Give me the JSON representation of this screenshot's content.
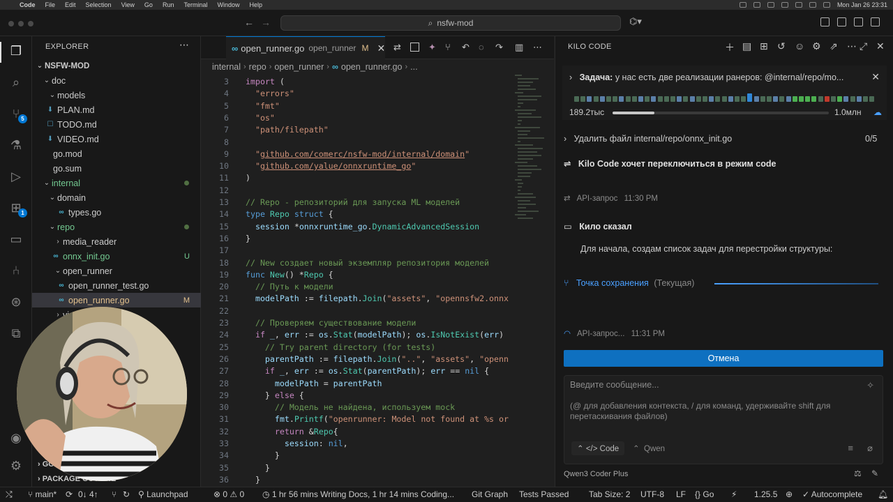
{
  "menubar": {
    "app": "Code",
    "items": [
      "File",
      "Edit",
      "Selection",
      "View",
      "Go",
      "Run",
      "Terminal",
      "Window",
      "Help"
    ],
    "clock": "Mon Jan 26  23:31"
  },
  "titlebar": {
    "search": "nsfw-mod"
  },
  "explorer": {
    "title": "EXPLORER",
    "root": "NSFW-MOD",
    "items": [
      {
        "label": "doc",
        "type": "folder-open",
        "indent": 1
      },
      {
        "label": "models",
        "type": "folder-open",
        "indent": 2
      },
      {
        "label": "PLAN.md",
        "type": "md",
        "indent": 2
      },
      {
        "label": "TODO.md",
        "type": "md",
        "indent": 2
      },
      {
        "label": "VIDEO.md",
        "type": "md",
        "indent": 2
      },
      {
        "label": "go.mod",
        "type": "file",
        "indent": 1
      },
      {
        "label": "go.sum",
        "type": "file",
        "indent": 1
      },
      {
        "label": "internal",
        "type": "folder-open",
        "indent": 1
      },
      {
        "label": "domain",
        "type": "folder-open",
        "indent": 2
      },
      {
        "label": "types.go",
        "type": "go",
        "indent": 3
      },
      {
        "label": "repo",
        "type": "folder-open",
        "indent": 2
      },
      {
        "label": "media_reader",
        "type": "folder-closed",
        "indent": 3
      },
      {
        "label": "onnx_init.go",
        "type": "go",
        "indent": 3,
        "status": "U"
      },
      {
        "label": "open_runner",
        "type": "folder-open",
        "indent": 3
      },
      {
        "label": "open_runner_test.go",
        "type": "go",
        "indent": 4
      },
      {
        "label": "open_runner.go",
        "type": "go",
        "indent": 4,
        "status": "M",
        "selected": true
      },
      {
        "label": "vi",
        "type": "folder-closed",
        "indent": 3
      }
    ],
    "bottom_sections": [
      "GO",
      "PACKAGE OUTLINE"
    ]
  },
  "editor": {
    "tab": {
      "name": "open_runner.go",
      "sub": "open_runner",
      "status": "M"
    },
    "breadcrumbs": [
      "internal",
      "repo",
      "open_runner",
      "open_runner.go",
      "..."
    ],
    "lines": [
      {
        "n": "3",
        "t": "import ("
      },
      {
        "n": "4",
        "t": "  \"errors\""
      },
      {
        "n": "5",
        "t": "  \"fmt\""
      },
      {
        "n": "6",
        "t": "  \"os\""
      },
      {
        "n": "7",
        "t": "  \"path/filepath\""
      },
      {
        "n": "8",
        "t": ""
      },
      {
        "n": "9",
        "t": "  \"github.com/comerc/nsfw-mod/internal/domain\""
      },
      {
        "n": "10",
        "t": "  \"github.com/yalue/onnxruntime_go\""
      },
      {
        "n": "11",
        "t": ")"
      },
      {
        "n": "12",
        "t": ""
      },
      {
        "n": "13",
        "t": "// Repo - репозиторий для запуска ML моделей"
      },
      {
        "n": "14",
        "t": "type Repo struct {"
      },
      {
        "n": "15",
        "t": "  session *onnxruntime_go.DynamicAdvancedSession"
      },
      {
        "n": "16",
        "t": "}"
      },
      {
        "n": "17",
        "t": ""
      },
      {
        "n": "18",
        "t": "// New создает новый экземпляр репозитория моделей"
      },
      {
        "n": "19",
        "t": "func New() *Repo {"
      },
      {
        "n": "20",
        "t": "  // Путь к модели"
      },
      {
        "n": "21",
        "t": "  modelPath := filepath.Join(\"assets\", \"opennsfw2.onnx"
      },
      {
        "n": "22",
        "t": ""
      },
      {
        "n": "23",
        "t": "  // Проверяем существование модели"
      },
      {
        "n": "24",
        "t": "  if _, err := os.Stat(modelPath); os.IsNotExist(err)"
      },
      {
        "n": "25",
        "t": "    // Try parent directory (for tests)"
      },
      {
        "n": "26",
        "t": "    parentPath := filepath.Join(\"..\", \"assets\", \"openn"
      },
      {
        "n": "27",
        "t": "    if _, err := os.Stat(parentPath); err == nil {"
      },
      {
        "n": "28",
        "t": "      modelPath = parentPath"
      },
      {
        "n": "29",
        "t": "    } else {"
      },
      {
        "n": "30",
        "t": "      // Модель не найдена, используем mock"
      },
      {
        "n": "31",
        "t": "      fmt.Printf(\"openrunner: Model not found at %s or"
      },
      {
        "n": "32",
        "t": "      return &Repo{"
      },
      {
        "n": "33",
        "t": "        session: nil,"
      },
      {
        "n": "34",
        "t": "      }"
      },
      {
        "n": "35",
        "t": "    }"
      },
      {
        "n": "36",
        "t": "  }"
      }
    ]
  },
  "kilo": {
    "title": "KILO CODE",
    "task_label": "Задача:",
    "task_text": "у нас есть две реализации ранеров: @internal/repo/mo...",
    "tokens_used": "189.2тыс",
    "tokens_max": "1.0млн",
    "todo_text": "Удалить файл internal/repo/onnx_init.go",
    "todo_count": "0/5",
    "switch_mode": "Kilo Code хочет переключиться в режим code",
    "api1_label": "API-запрос",
    "api1_time": "11:30 PM",
    "said_label": "Кило сказал",
    "said_text": "Для начала, создам список задач для перестройки структуры:",
    "checkpoint": "Точка сохранения",
    "checkpoint_sub": "(Текущая)",
    "api2_label": "API-запрос...",
    "api2_time": "11:31 PM",
    "cancel": "Отмена",
    "input_placeholder": "Введите сообщение...",
    "input_hint": "(@ для добавления контекста, / для команд, удерживайте shift для перетаскивания файлов)",
    "mode": "Code",
    "profile": "Qwen",
    "model": "Qwen3 Coder Plus",
    "segment_colors": [
      "#4a6a55",
      "#4a6a55",
      "#5b7fa8",
      "#4a6a55",
      "#5b7fa8",
      "#4a6a55",
      "#4a6a55",
      "#5b7fa8",
      "#4a6a55",
      "#4a6a55",
      "#5b7fa8",
      "#4a6a55",
      "#5b7fa8",
      "#4a6a55",
      "#4a6a55",
      "#4a6a55",
      "#5b7fa8",
      "#4a6a55",
      "#5b7fa8",
      "#4a6a55",
      "#4a6a55",
      "#5b7fa8",
      "#4a6a55",
      "#4a6a55",
      "#5b7fa8",
      "#4a6a55",
      "#4a6a55",
      "#2f87d8",
      "#5b7fa8",
      "#4a6a55",
      "#4a6a55",
      "#5b7fa8",
      "#4a6a55",
      "#5b7fa8",
      "#4caf50",
      "#4caf50",
      "#4caf50",
      "#4caf50",
      "#4a6a55",
      "#c0392b",
      "#4a6a55",
      "#4caf50",
      "#5b7fa8",
      "#4a6a55",
      "#5b7fa8",
      "#4a6a55",
      "#4a6a55"
    ]
  },
  "status": {
    "branch": "main*",
    "sync": "0↓ 4↑",
    "launchpad": "Launchpad",
    "errors": "0",
    "warnings": "0",
    "wakatime": "1 hr 56 mins Writing Docs, 1 hr 14 mins Coding...",
    "git_graph": "Git Graph",
    "tests": "Tests Passed",
    "tab_size": "Tab Size: 2",
    "encoding": "UTF-8",
    "eol": "LF",
    "language": "Go",
    "go_version": "1.25.5",
    "autocomplete": "Autocomplete"
  }
}
